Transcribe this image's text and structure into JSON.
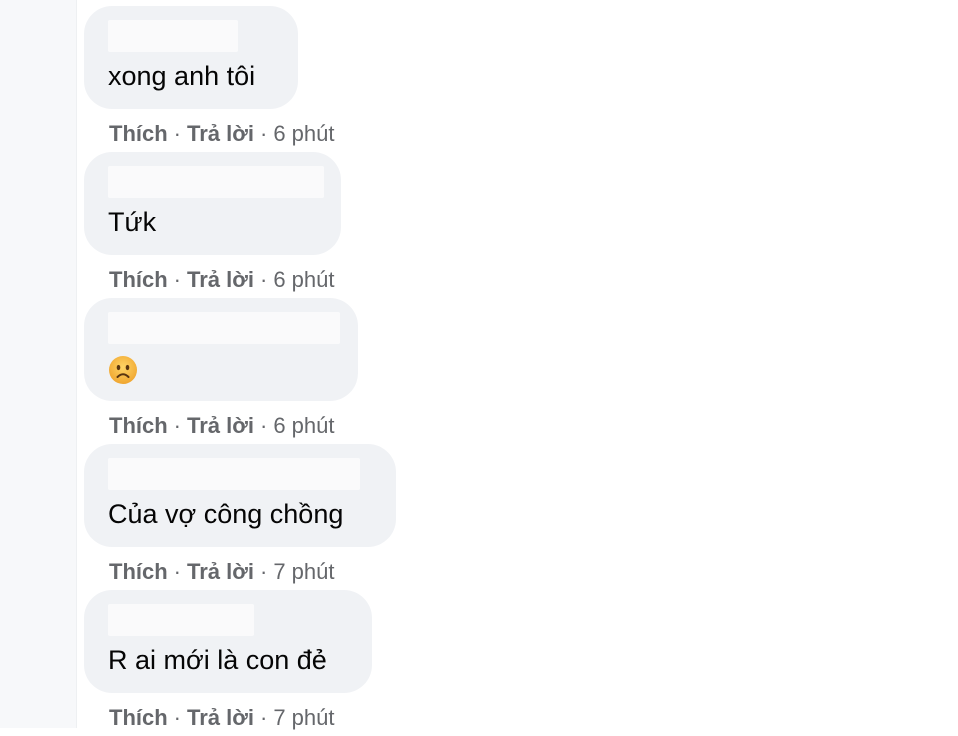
{
  "actions": {
    "like": "Thích",
    "reply": "Trả lời",
    "separator": "·"
  },
  "comments": [
    {
      "text": "xong anh tôi",
      "time": "6 phút"
    },
    {
      "text": "Tứk",
      "time": "6 phút"
    },
    {
      "text": "",
      "emoji": "frowning-face",
      "time": "6 phút"
    },
    {
      "text": "Của vợ công chồng",
      "time": "7 phút"
    },
    {
      "text": "R ai mới là con đẻ",
      "time": "7 phút"
    }
  ],
  "colors": {
    "bubble": "#f0f2f5",
    "text": "#050505",
    "meta": "#65676b",
    "emoji_face": "#f5b73a"
  }
}
